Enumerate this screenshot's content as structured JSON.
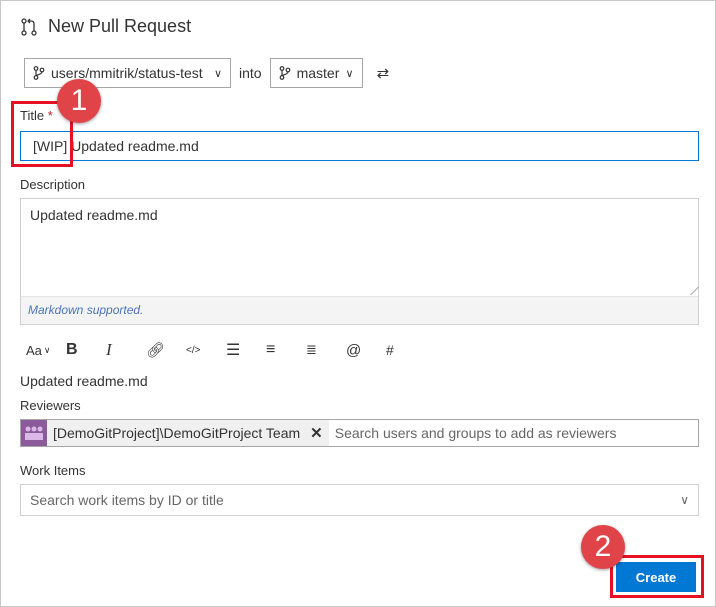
{
  "header": {
    "title": "New Pull Request",
    "icon": "pull-request-icon"
  },
  "branches": {
    "source": "users/mmitrik/status-test",
    "into_label": "into",
    "target": "master",
    "swap_icon": "swap-icon"
  },
  "title_field": {
    "label": "Title",
    "required_mark": "*",
    "value": "[WIP] Updated readme.md"
  },
  "description": {
    "label": "Description",
    "value": "Updated readme.md",
    "footer": "Markdown supported."
  },
  "toolbar": {
    "items": [
      "Aa",
      "B",
      "I",
      "link",
      "code",
      "bulleted-list",
      "numbered-list",
      "checklist",
      "@",
      "#"
    ]
  },
  "preview_text": "Updated readme.md",
  "reviewers": {
    "label": "Reviewers",
    "chip": "[DemoGitProject]\\DemoGitProject Team",
    "remove": "✕",
    "placeholder": "Search users and groups to add as reviewers"
  },
  "work_items": {
    "label": "Work Items",
    "placeholder": "Search work items by ID or title"
  },
  "create_button": "Create",
  "callouts": [
    "1",
    "2"
  ],
  "colors": {
    "accent": "#0078d4",
    "highlight": "#e81123",
    "badge": "#e04448"
  }
}
